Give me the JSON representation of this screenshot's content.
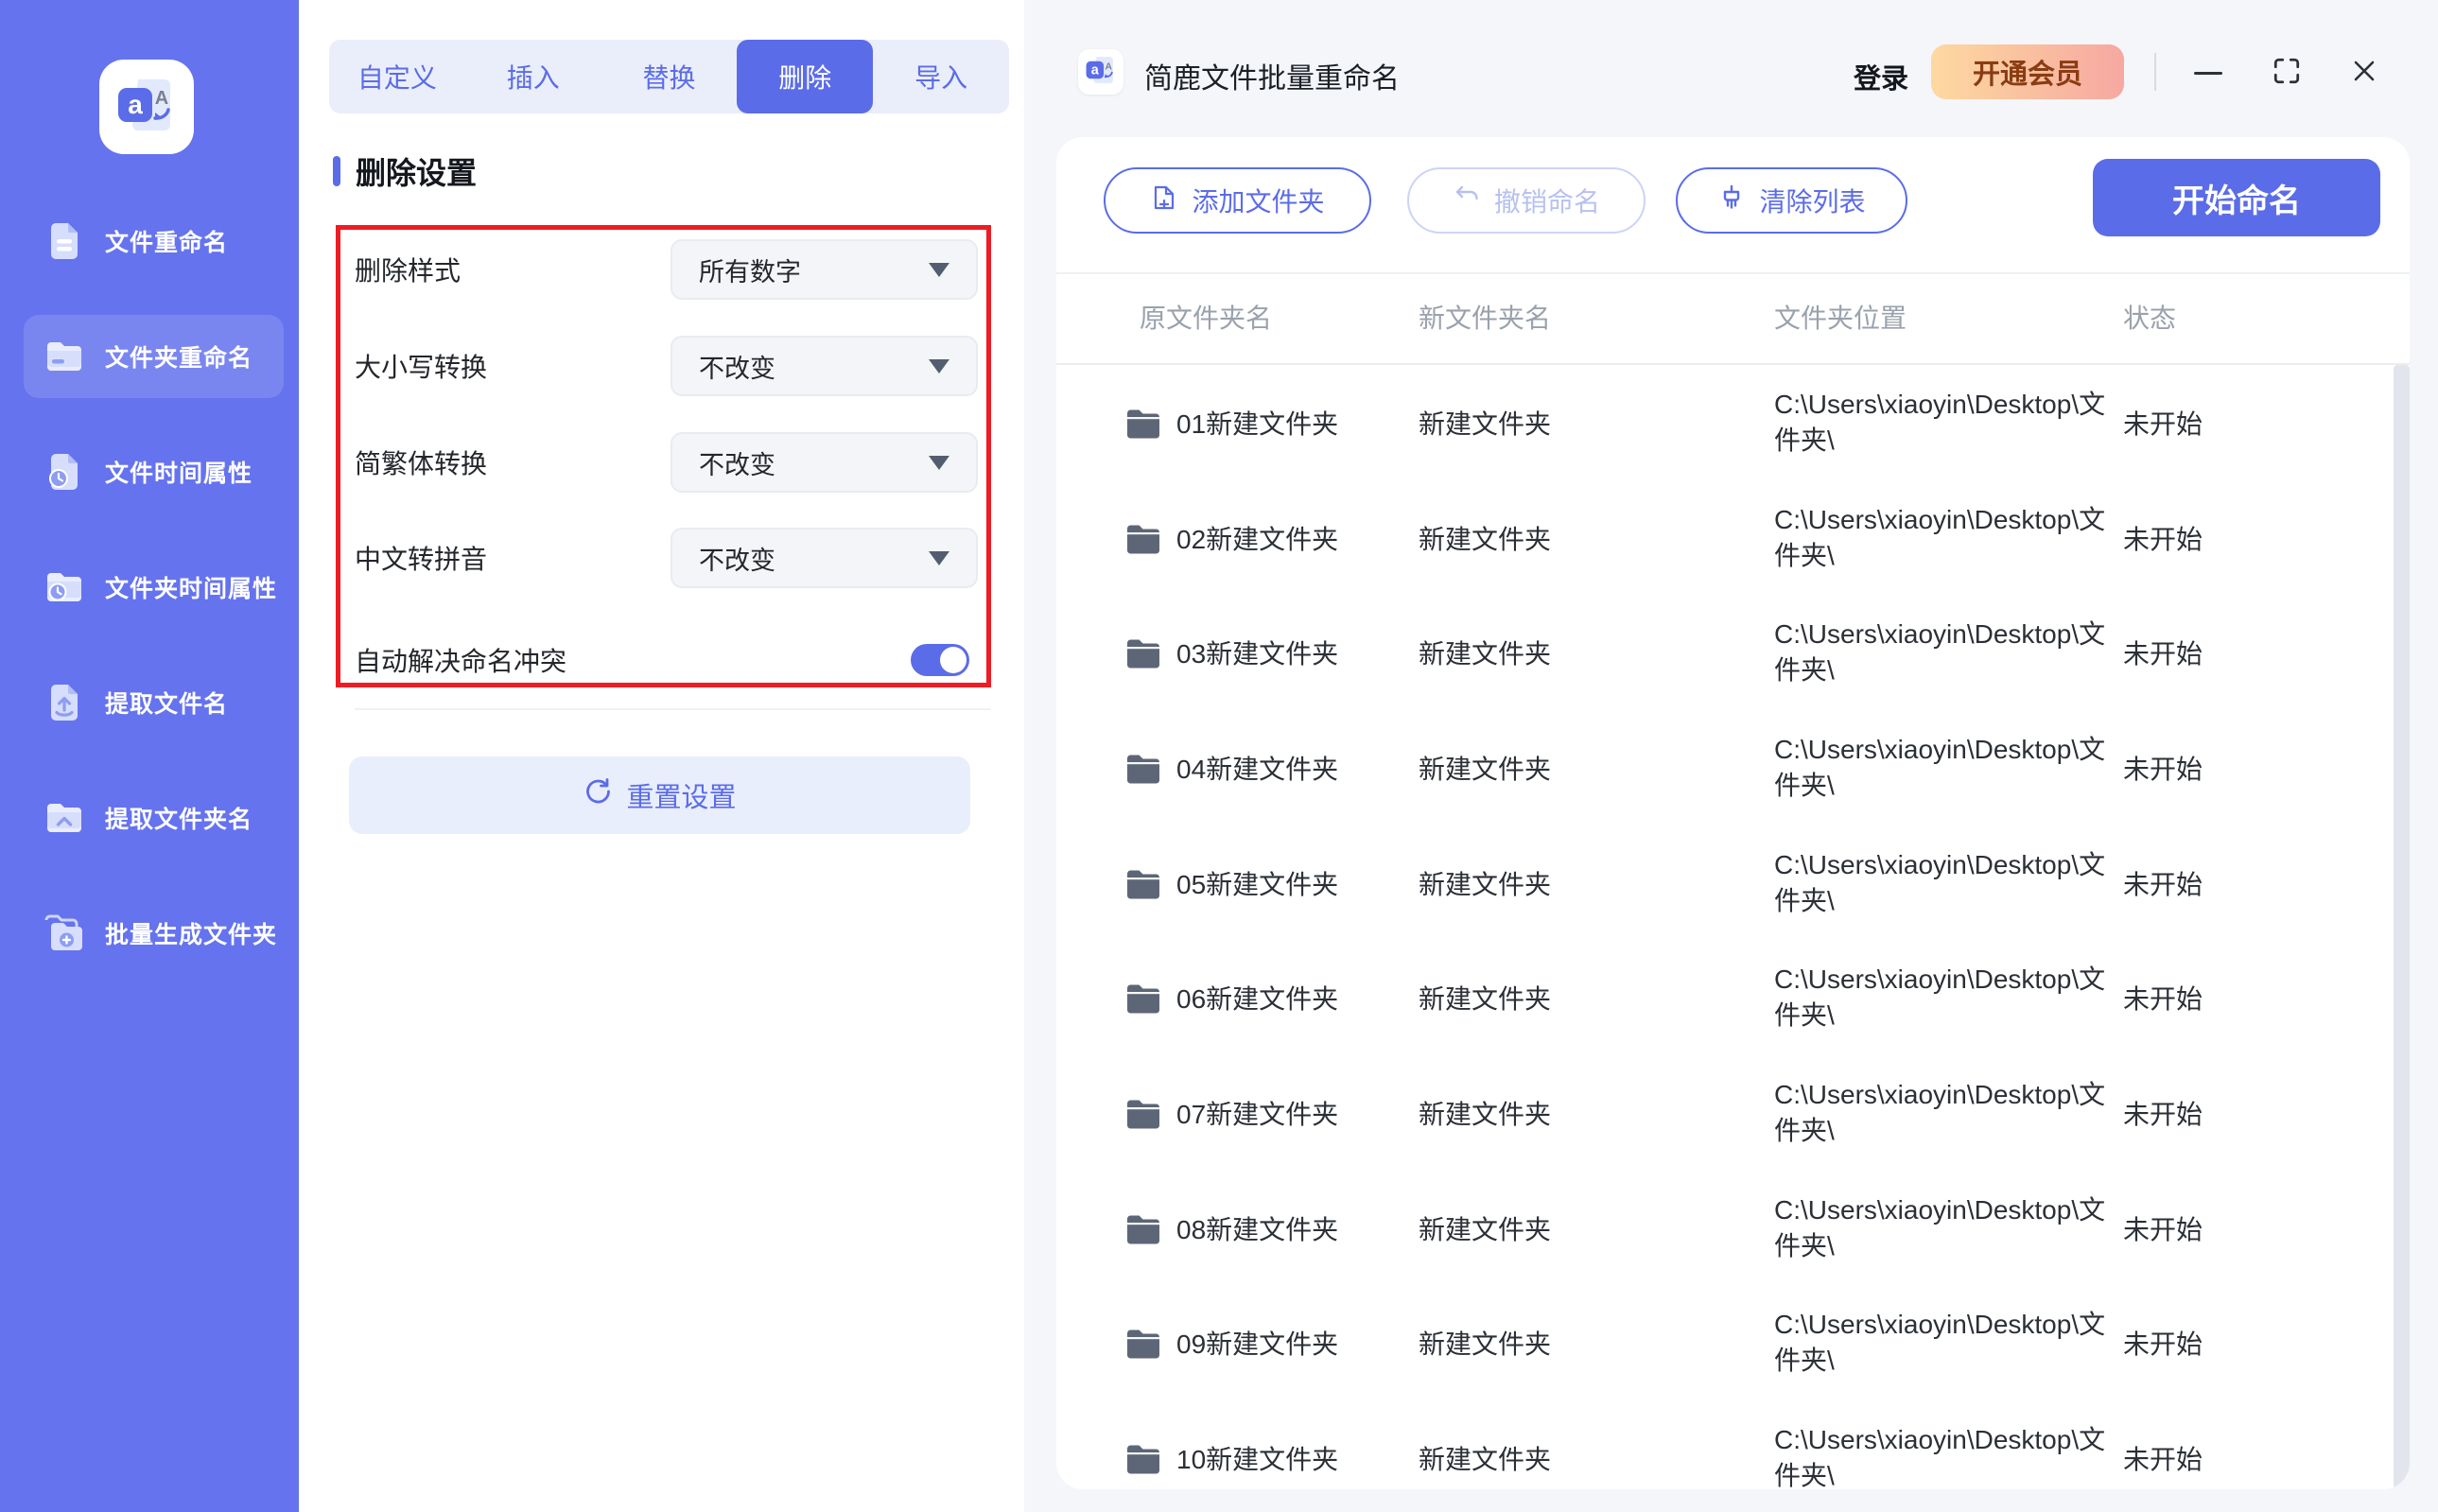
{
  "app": {
    "window_title": "简鹿文件批量重命名"
  },
  "colors": {
    "accent_blue": "#5b6ce8",
    "sidebar_blue": "#6573ee",
    "annotation_red": "#ee1c24",
    "vip_gradient_start": "#fdd9a0",
    "vip_gradient_end": "#f6a8a1",
    "page_background": "#f5f6fa"
  },
  "sidebar": {
    "items": [
      {
        "label": "文件重命名",
        "icon": "file-rename-icon",
        "active": false
      },
      {
        "label": "文件夹重命名",
        "icon": "folder-rename-icon",
        "active": true
      },
      {
        "label": "文件时间属性",
        "icon": "file-time-icon",
        "active": false
      },
      {
        "label": "文件夹时间属性",
        "icon": "folder-time-icon",
        "active": false
      },
      {
        "label": "提取文件名",
        "icon": "extract-filename-icon",
        "active": false
      },
      {
        "label": "提取文件夹名",
        "icon": "extract-foldername-icon",
        "active": false
      },
      {
        "label": "批量生成文件夹",
        "icon": "batch-create-folder-icon",
        "active": false
      }
    ]
  },
  "tabs": {
    "items": [
      "自定义",
      "插入",
      "替换",
      "删除",
      "导入"
    ],
    "active_index": 3
  },
  "settings": {
    "section_title": "删除设置",
    "fields": [
      {
        "label": "删除样式",
        "value": "所有数字"
      },
      {
        "label": "大小写转换",
        "value": "不改变"
      },
      {
        "label": "简繁体转换",
        "value": "不改变"
      },
      {
        "label": "中文转拼音",
        "value": "不改变"
      },
      {
        "label": "自动解决命名冲突",
        "value": "on"
      }
    ],
    "reset_label": "重置设置"
  },
  "titlebar": {
    "login_label": "登录",
    "vip_label": "开通会员"
  },
  "toolbar": {
    "add_folder_label": "添加文件夹",
    "undo_label": "撤销命名",
    "clear_label": "清除列表",
    "start_label": "开始命名"
  },
  "table": {
    "columns": [
      "原文件夹名",
      "新文件夹名",
      "文件夹位置",
      "状态"
    ],
    "rows": [
      {
        "original": "01新建文件夹",
        "new_name": "新建文件夹",
        "path": "C:\\Users\\xiaoyin\\Desktop\\文件夹\\",
        "status": "未开始"
      },
      {
        "original": "02新建文件夹",
        "new_name": "新建文件夹",
        "path": "C:\\Users\\xiaoyin\\Desktop\\文件夹\\",
        "status": "未开始"
      },
      {
        "original": "03新建文件夹",
        "new_name": "新建文件夹",
        "path": "C:\\Users\\xiaoyin\\Desktop\\文件夹\\",
        "status": "未开始"
      },
      {
        "original": "04新建文件夹",
        "new_name": "新建文件夹",
        "path": "C:\\Users\\xiaoyin\\Desktop\\文件夹\\",
        "status": "未开始"
      },
      {
        "original": "05新建文件夹",
        "new_name": "新建文件夹",
        "path": "C:\\Users\\xiaoyin\\Desktop\\文件夹\\",
        "status": "未开始"
      },
      {
        "original": "06新建文件夹",
        "new_name": "新建文件夹",
        "path": "C:\\Users\\xiaoyin\\Desktop\\文件夹\\",
        "status": "未开始"
      },
      {
        "original": "07新建文件夹",
        "new_name": "新建文件夹",
        "path": "C:\\Users\\xiaoyin\\Desktop\\文件夹\\",
        "status": "未开始"
      },
      {
        "original": "08新建文件夹",
        "new_name": "新建文件夹",
        "path": "C:\\Users\\xiaoyin\\Desktop\\文件夹\\",
        "status": "未开始"
      },
      {
        "original": "09新建文件夹",
        "new_name": "新建文件夹",
        "path": "C:\\Users\\xiaoyin\\Desktop\\文件夹\\",
        "status": "未开始"
      },
      {
        "original": "10新建文件夹",
        "new_name": "新建文件夹",
        "path": "C:\\Users\\xiaoyin\\Desktop\\文件夹\\",
        "status": "未开始"
      }
    ]
  }
}
